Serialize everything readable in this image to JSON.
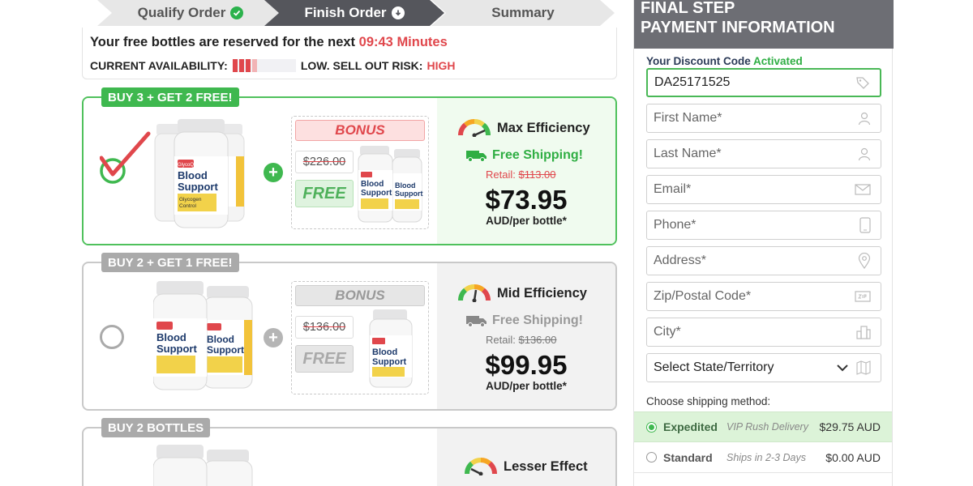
{
  "steps": [
    {
      "label": "Qualify Order",
      "icon": "check-circle-icon"
    },
    {
      "label": "Finish Order",
      "icon": "download-circle-icon"
    },
    {
      "label": "Summary"
    }
  ],
  "timer": {
    "prefix": "Your free bottles are reserved for the next",
    "countdown": "09:43 Minutes",
    "availability_label": "CURRENT AVAILABILITY:",
    "availability_level": 0.4,
    "risk_label": "LOW. SELL OUT RISK:",
    "risk_value": "HIGH"
  },
  "offers": [
    {
      "tag": "BUY 3 + GET 2 FREE!",
      "selected": true,
      "bonus_label": "BONUS",
      "old_price": "$226.00",
      "free_label": "FREE",
      "efficiency": "Max Efficiency",
      "shipping": "Free Shipping!",
      "retail_label": "Retail:",
      "retail_price": "$113.00",
      "price": "$73.95",
      "per": "AUD/per bottle*"
    },
    {
      "tag": "BUY 2 + GET 1 FREE!",
      "selected": false,
      "bonus_label": "BONUS",
      "old_price": "$136.00",
      "free_label": "FREE",
      "efficiency": "Mid Efficiency",
      "shipping": "Free Shipping!",
      "retail_label": "Retail:",
      "retail_price": "$136.00",
      "price": "$99.95",
      "per": "AUD/per bottle*"
    },
    {
      "tag": "BUY 2 BOTTLES",
      "selected": false,
      "efficiency": "Lesser Effect"
    }
  ],
  "product": {
    "brand": "GlycoQ",
    "name_line1": "Blood",
    "name_line2": "Support",
    "subtitle": "Glycogen Control"
  },
  "form": {
    "title_line1": "FINAL STEP",
    "title_line2": "PAYMENT INFORMATION",
    "discount_label": "Your Discount Code",
    "discount_status": "Activated",
    "discount_code": "DA25171525",
    "fields": [
      {
        "placeholder": "First Name*",
        "icon": "user-icon"
      },
      {
        "placeholder": "Last Name*",
        "icon": "user-icon"
      },
      {
        "placeholder": "Email*",
        "icon": "envelope-icon"
      },
      {
        "placeholder": "Phone*",
        "icon": "phone-icon"
      },
      {
        "placeholder": "Address*",
        "icon": "map-pin-icon"
      },
      {
        "placeholder": "Zip/Postal Code*",
        "icon": "zip-icon"
      },
      {
        "placeholder": "City*",
        "icon": "building-icon"
      }
    ],
    "state_select": "Select State/Territory",
    "shipping_label": "Choose shipping method:",
    "shipping_options": [
      {
        "name": "Expedited",
        "desc": "VIP Rush Delivery",
        "amount": "$29.75 AUD",
        "selected": true
      },
      {
        "name": "Standard",
        "desc": "Ships in 2-3 Days",
        "amount": "$0.00 AUD",
        "selected": false
      }
    ]
  },
  "colors": {
    "accent_green": "#3fb84f",
    "alert_red": "#e0474c",
    "header_grey": "#6d6e74",
    "step_active": "#55565c"
  }
}
